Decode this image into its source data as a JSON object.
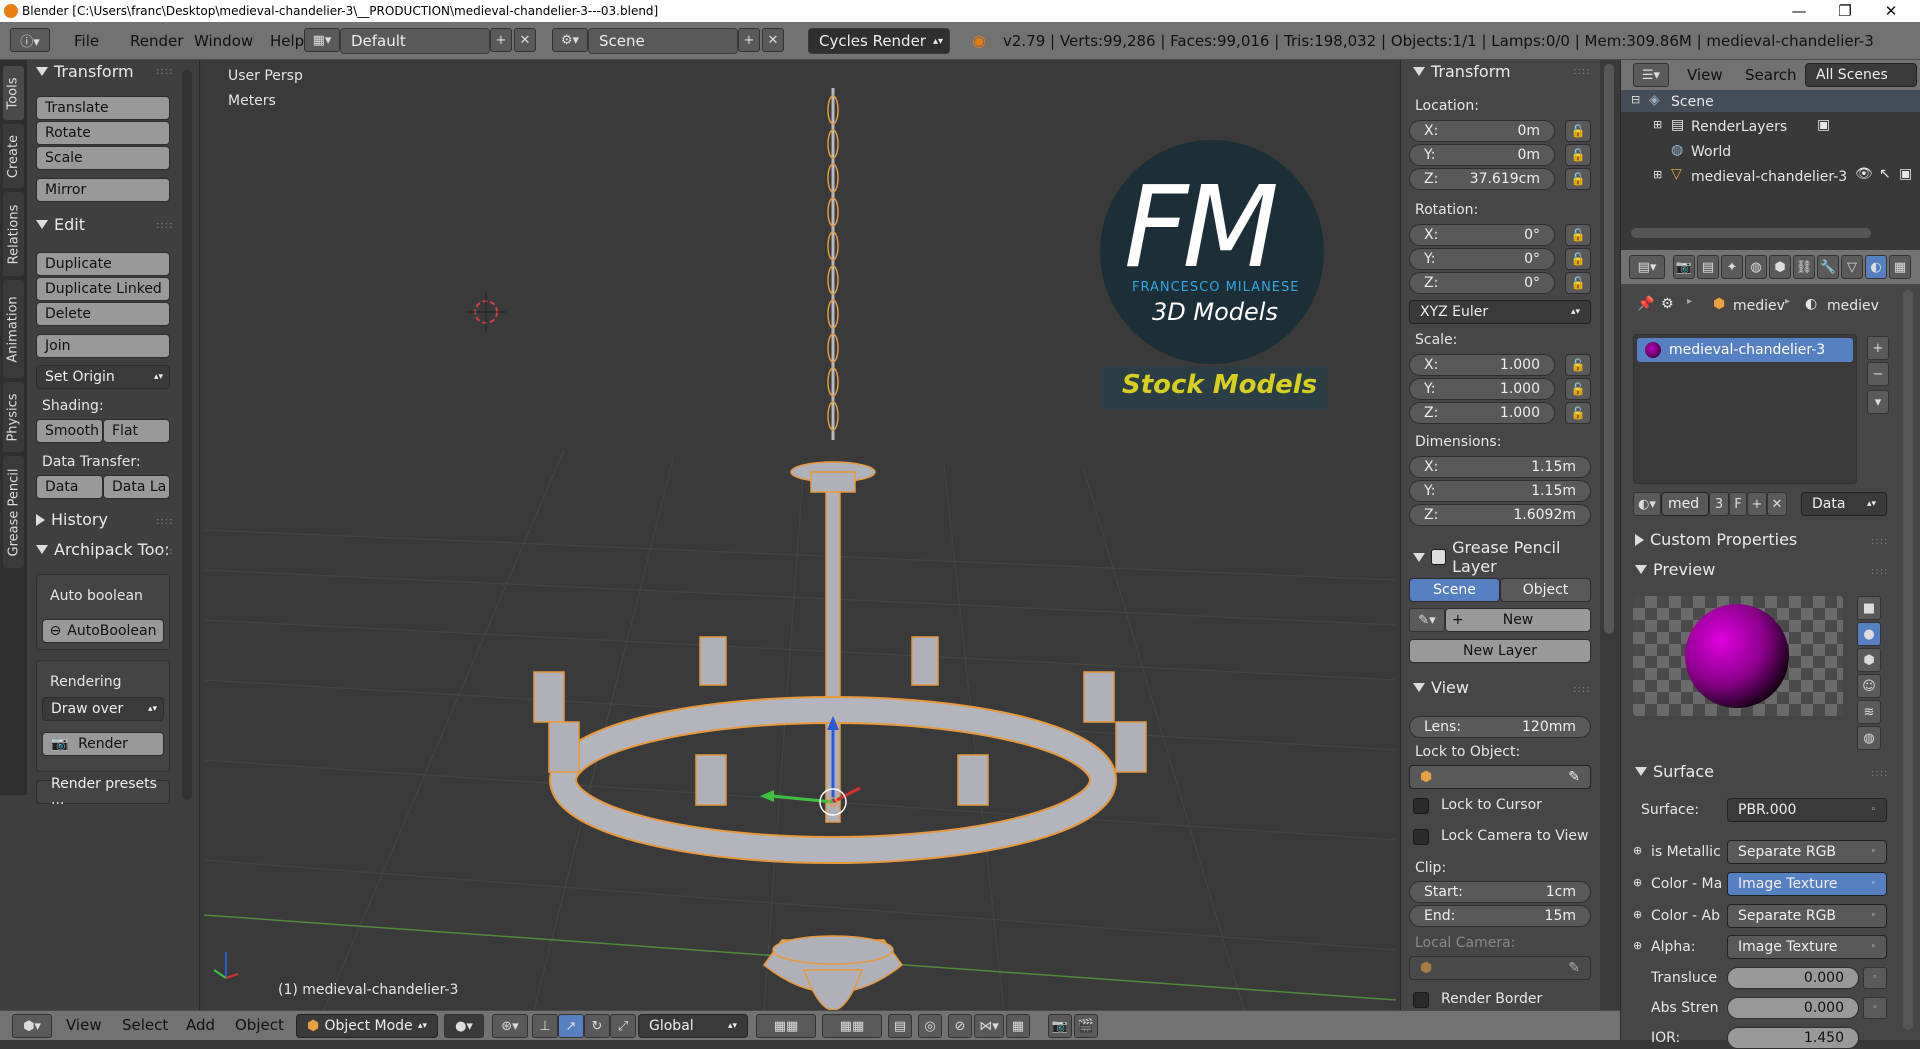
{
  "window": {
    "title": "Blender [C:\\Users\\franc\\Desktop\\medieval-chandelier-3\\__PRODUCTION\\medieval-chandelier-3---03.blend]",
    "minimize": "—",
    "maximize": "❐",
    "close": "✕"
  },
  "topbar": {
    "menus": [
      "File",
      "Render",
      "Window",
      "Help"
    ],
    "layout": "Default",
    "scene": "Scene",
    "engine": "Cycles Render",
    "stats": "v2.79 | Verts:99,286 | Faces:99,016 | Tris:198,032 | Objects:1/1 | Lamps:0/0 | Mem:309.86M | medieval-chandelier-3"
  },
  "tool_tabs": [
    "Tools",
    "Create",
    "Relations",
    "Animation",
    "Physics",
    "Grease Pencil"
  ],
  "tools": {
    "transform_header": "Transform",
    "translate": "Translate",
    "rotate": "Rotate",
    "scale": "Scale",
    "mirror": "Mirror",
    "edit_header": "Edit",
    "duplicate": "Duplicate",
    "duplicate_linked": "Duplicate Linked",
    "delete": "Delete",
    "join": "Join",
    "set_origin": "Set Origin",
    "shading_label": "Shading:",
    "smooth": "Smooth",
    "flat": "Flat",
    "data_transfer_label": "Data Transfer:",
    "data": "Data",
    "data_la": "Data La",
    "history_header": "History",
    "archipack_header": "Archipack Too:",
    "auto_boolean_label": "Auto boolean",
    "auto_boolean_btn": "AutoBoolean",
    "rendering_label": "Rendering",
    "draw_over": "Draw over",
    "render_btn": "Render",
    "render_presets": "Render presets ..."
  },
  "viewport": {
    "view_name": "User Persp",
    "units": "Meters",
    "object_label": "(1) medieval-chandelier-3",
    "logo_letters": "FM",
    "logo_name": "FRANCESCO MILANESE",
    "logo_sub": "3D Models",
    "logo_banner": "Stock Models"
  },
  "npanel": {
    "transform_header": "Transform",
    "location_label": "Location:",
    "loc_x": "0m",
    "loc_y": "0m",
    "loc_z": "37.619cm",
    "rotation_label": "Rotation:",
    "rot_x": "0°",
    "rot_y": "0°",
    "rot_z": "0°",
    "rotation_mode": "XYZ Euler",
    "scale_label": "Scale:",
    "scale_x": "1.000",
    "scale_y": "1.000",
    "scale_z": "1.000",
    "dimensions_label": "Dimensions:",
    "dim_x": "1.15m",
    "dim_y": "1.15m",
    "dim_z": "1.6092m",
    "axis_x": "X:",
    "axis_y": "Y:",
    "axis_z": "Z:",
    "grease_header": "Grease Pencil Layer",
    "gp_scene": "Scene",
    "gp_object": "Object",
    "gp_new": "New",
    "gp_new_layer": "New Layer",
    "view_header": "View",
    "lens_label": "Lens:",
    "lens_value": "120mm",
    "lock_object_label": "Lock to Object:",
    "lock_cursor": "Lock to Cursor",
    "lock_camera": "Lock Camera to View",
    "clip_label": "Clip:",
    "clip_start_label": "Start:",
    "clip_start": "1cm",
    "clip_end_label": "End:",
    "clip_end": "15m",
    "local_camera": "Local Camera:",
    "render_border": "Render Border"
  },
  "outliner": {
    "view": "View",
    "search": "Search",
    "all_scenes": "All Scenes",
    "items": [
      "Scene",
      "RenderLayers",
      "World",
      "medieval-chandelier-3"
    ]
  },
  "properties": {
    "crumb1": "mediev",
    "crumb2": "mediev",
    "material_slot": "medieval-chandelier-3",
    "mat_name": "med",
    "mat_users": "3",
    "mat_fake": "F",
    "link_type": "Data",
    "custom_props": "Custom Properties",
    "preview": "Preview",
    "surface_header": "Surface",
    "surface_label": "Surface:",
    "surface_value": "PBR.000",
    "rows": [
      {
        "label": "is Metallic",
        "value": "Separate RGB"
      },
      {
        "label": "Color - Ma",
        "value": "Image Texture"
      },
      {
        "label": "Color - Ab",
        "value": "Separate RGB"
      },
      {
        "label": "Alpha:",
        "value": "Image Texture"
      }
    ],
    "translucency_label": "Transluce",
    "translucency_value": "0.000",
    "abs_strength_label": "Abs Stren",
    "abs_strength_value": "0.000",
    "ior_label": "IOR:",
    "ior_value": "1.450"
  },
  "bottombar": {
    "view": "View",
    "select": "Select",
    "add": "Add",
    "object": "Object",
    "mode": "Object Mode",
    "orientation": "Global"
  },
  "colors": {
    "accent": "#5680c2",
    "selection_outline": "#f0a040",
    "logo_blue": "#2ea8e0",
    "banner_yellow": "#d8d020"
  }
}
